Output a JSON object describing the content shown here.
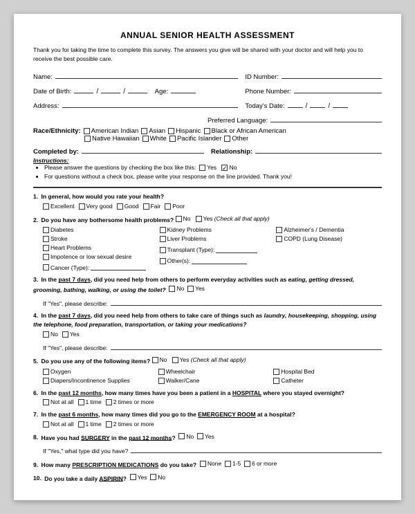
{
  "title": "ANNUAL SENIOR HEALTH ASSESSMENT",
  "intro": "Thank you for taking the time to complete this survey. The answers you give will be shared with your doctor and will help you to receive the best possible care.",
  "fields": {
    "name_label": "Name:",
    "id_label": "ID Number:",
    "dob_label": "Date of Birth:",
    "dob_slash1": "/",
    "dob_slash2": "/",
    "age_label": "Age:",
    "phone_label": "Phone Number:",
    "address_label": "Address:",
    "today_label": "Today's Date:",
    "today_slash1": "/",
    "today_slash2": "/",
    "pref_lang_label": "Preferred Language:",
    "race_label": "Race/Ethnicity:",
    "completed_label": "Completed by:",
    "relationship_label": "Relationship:"
  },
  "race_options": [
    "American Indian",
    "Asian",
    "Hispanic",
    "Black or African American",
    "Native Hawaiian",
    "White",
    "Pacific Islander",
    "Other"
  ],
  "instructions": {
    "label": "Instructions:",
    "items": [
      "Please answer the questions by checking the box like this:  □ Yes ☑ No",
      "For questions without a check box, please write your response on the line provided. Thank you!"
    ]
  },
  "questions": [
    {
      "num": "1.",
      "text": "In general, how would you rate your health?",
      "options": [
        "Excellent",
        "Very good",
        "Good",
        "Fair",
        "Poor"
      ]
    },
    {
      "num": "2.",
      "text": "Do you have any bothersome health problems?",
      "inline_options": [
        "No",
        "Yes (Check all that apply)"
      ],
      "sub_options_col1": [
        "Diabetes",
        "Stroke",
        "Heart Problems",
        "Impotence or low sexual desire",
        "Cancer (Type):"
      ],
      "sub_options_col2": [
        "Kidney Problems",
        "Liver Problems",
        "Transplant (Type):",
        "Other(s):"
      ],
      "sub_options_col3": [
        "Alzheimer's / Dementia",
        "COPD (Lung Disease)"
      ]
    },
    {
      "num": "3.",
      "text": "In the past 7 days, did you need help from others to perform everyday activities such as eating, getting dressed, grooming, bathing, walking, or using the toilet?",
      "inline_options": [
        "No",
        "Yes"
      ],
      "followup": "If \"Yes\", please describe:"
    },
    {
      "num": "4.",
      "text": "In the past 7 days, did you need help from others to take care of things such as laundry, housekeeping, shopping, using the telephone, food preparation, transportation, or taking your medications?",
      "options_row": [
        "No",
        "Yes"
      ],
      "followup": "If \"Yes\", please describe:"
    },
    {
      "num": "5.",
      "text": "Do you use any of the following items?",
      "inline_options": [
        "No",
        "Yes (Check all that apply)"
      ],
      "items_row1": [
        "Oxygen",
        "Wheelchair",
        "Hospital Bed"
      ],
      "items_row2": [
        "Diapers/Incontinence Supplies",
        "Walker/Cane",
        "Catheter"
      ]
    },
    {
      "num": "6.",
      "text": "In the past 12 months, how many times have you been a patient in a HOSPITAL where you stayed overnight?",
      "options": [
        "Not at all",
        "1 time",
        "2 times or more"
      ]
    },
    {
      "num": "7.",
      "text": "In the past 6 months, how many times did you go to the EMERGENCY ROOM at a hospital?",
      "options": [
        "Not at all",
        "1 time",
        "2 times or more"
      ]
    },
    {
      "num": "8.",
      "text": "Have you had SURGERY in the past 12 months?",
      "inline_options": [
        "No",
        "Yes"
      ],
      "followup": "If \"Yes,\" what type did you have?"
    },
    {
      "num": "9.",
      "text": "How many PRESCRIPTION MEDICATIONS do you take?",
      "options": [
        "None",
        "1-5",
        "6 or more"
      ]
    },
    {
      "num": "10.",
      "text": "Do you take a daily ASPIRIN?",
      "options": [
        "Yes",
        "No"
      ]
    }
  ]
}
